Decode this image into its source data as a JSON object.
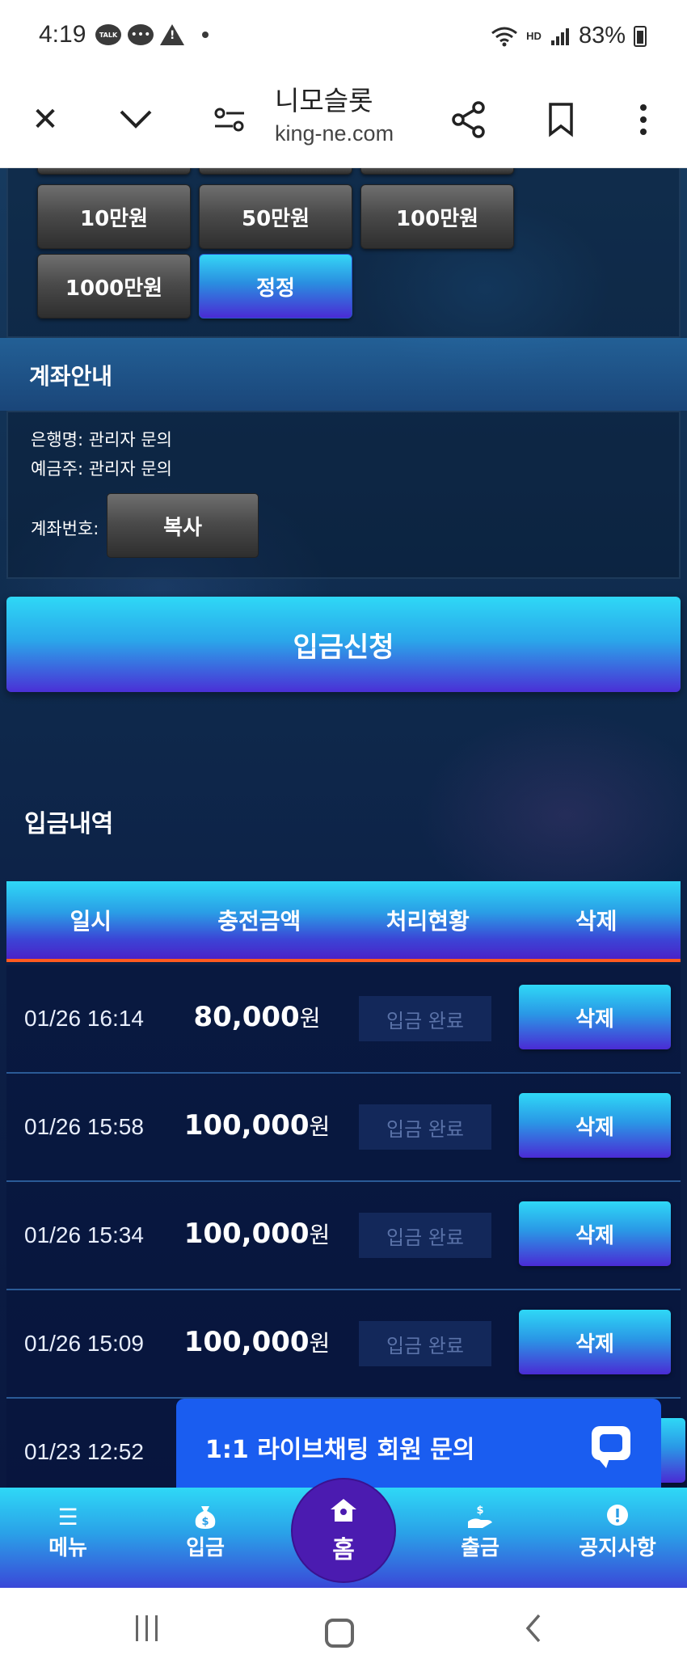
{
  "status_bar": {
    "time": "4:19",
    "battery": "83%",
    "hd_label": "HD"
  },
  "browser": {
    "title": "니모슬롯",
    "url": "king-ne.com"
  },
  "amount_buttons": [
    {
      "label": "10만원"
    },
    {
      "label": "50만원"
    },
    {
      "label": "100만원"
    },
    {
      "label": "1000만원"
    },
    {
      "label": "정정"
    }
  ],
  "account": {
    "section_title": "계좌안내",
    "bank": "은행명: 관리자 문의",
    "holder": "예금주: 관리자 문의",
    "number_label": "계좌번호:",
    "copy_label": "복사"
  },
  "deposit_button": "입금신청",
  "history": {
    "title": "입금내역",
    "columns": [
      "일시",
      "충전금액",
      "처리현황",
      "삭제"
    ],
    "rows": [
      {
        "date": "01/26 16:14",
        "amount": "80,000",
        "unit": "원",
        "status": "입금 완료",
        "delete": "삭제"
      },
      {
        "date": "01/26 15:58",
        "amount": "100,000",
        "unit": "원",
        "status": "입금 완료",
        "delete": "삭제"
      },
      {
        "date": "01/26 15:34",
        "amount": "100,000",
        "unit": "원",
        "status": "입금 완료",
        "delete": "삭제"
      },
      {
        "date": "01/26 15:09",
        "amount": "100,000",
        "unit": "원",
        "status": "입금 완료",
        "delete": "삭제"
      },
      {
        "date": "01/23 12:52",
        "amount": "",
        "unit": "",
        "status": "",
        "delete": ""
      }
    ]
  },
  "live_chat": {
    "label": "1:1 라이브채팅 회원 문의"
  },
  "bottom_nav": {
    "menu": "메뉴",
    "deposit": "입금",
    "home": "홈",
    "withdraw": "출금",
    "notice": "공지사항"
  }
}
